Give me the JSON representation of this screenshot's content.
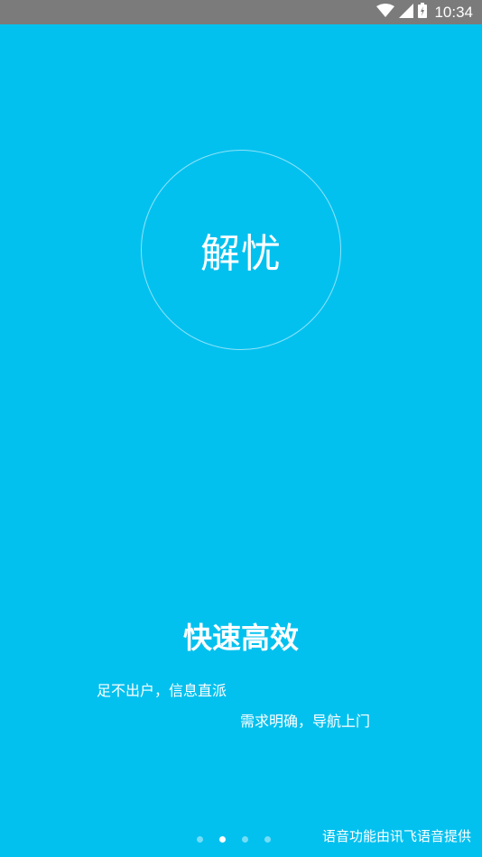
{
  "status_bar": {
    "time": "10:34",
    "icons": [
      "wifi-icon",
      "signal-icon",
      "battery-icon"
    ]
  },
  "hero": {
    "circle_label": "解忧"
  },
  "slide": {
    "headline": "快速高效",
    "line1": "足不出户，信息直派",
    "line2": "需求明确，导航上门"
  },
  "pager": {
    "total": 4,
    "active_index": 1
  },
  "footer": {
    "voice_credit": "语音功能由讯飞语音提供"
  },
  "colors": {
    "background": "#03c1ef",
    "status_bar": "#7b7b7b",
    "text": "#ffffff"
  }
}
